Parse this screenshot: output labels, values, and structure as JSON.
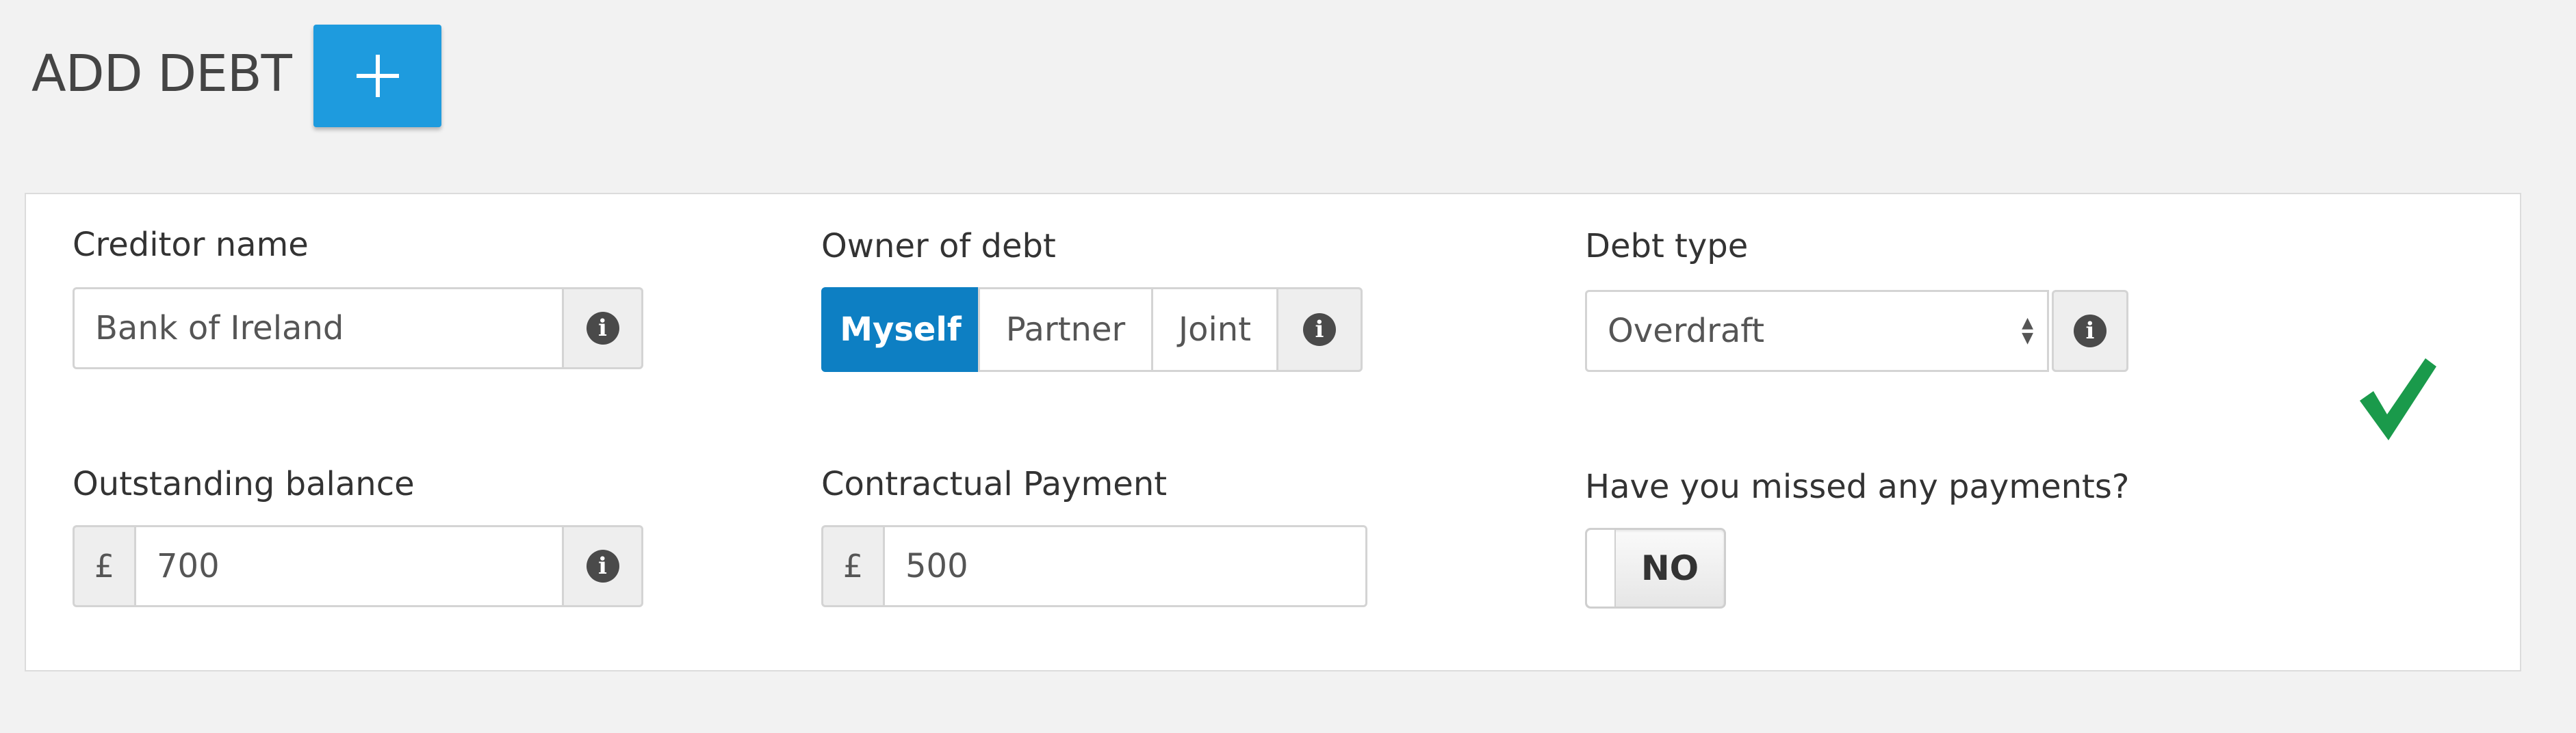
{
  "header": {
    "title": "ADD DEBT",
    "add_button_icon": "plus-icon"
  },
  "form": {
    "creditor_name": {
      "label": "Creditor name",
      "value": "Bank of Ireland",
      "info_icon": "info-icon"
    },
    "owner_of_debt": {
      "label": "Owner of debt",
      "options": [
        "Myself",
        "Partner",
        "Joint"
      ],
      "selected": "Myself",
      "info_icon": "info-icon"
    },
    "debt_type": {
      "label": "Debt type",
      "value": "Overdraft",
      "info_icon": "info-icon"
    },
    "outstanding_balance": {
      "label": "Outstanding balance",
      "currency": "£",
      "value": "700",
      "info_icon": "info-icon"
    },
    "contractual_payment": {
      "label": "Contractual Payment",
      "currency": "£",
      "value": "500"
    },
    "missed_payments": {
      "label": "Have you missed any payments?",
      "toggle_value": "NO"
    },
    "status_icon": "checkmark-icon"
  },
  "colors": {
    "accent": "#1e9bde",
    "segment_active": "#0d7fc3",
    "checkmark": "#1a9a4b",
    "background": "#f2f2f2"
  }
}
